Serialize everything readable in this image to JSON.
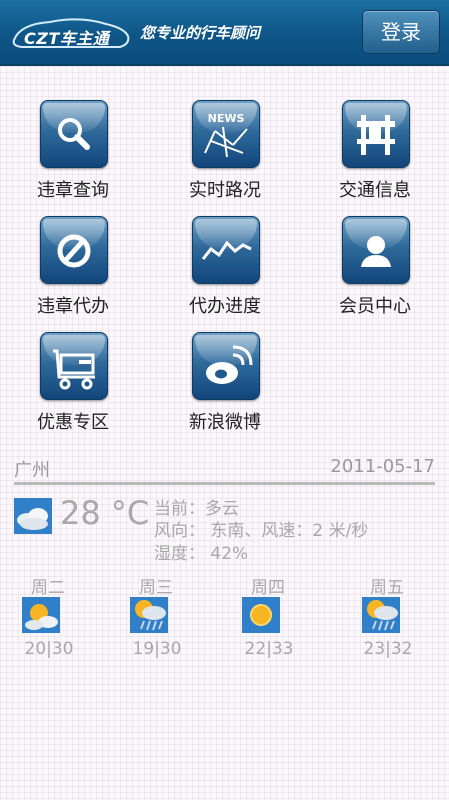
{
  "header": {
    "logo_text": "CZT车主通",
    "slogan": "您专业的行车顾问",
    "login_label": "登录"
  },
  "menu": [
    {
      "label": "违章查询",
      "icon": "search-icon"
    },
    {
      "label": "实时路况",
      "icon": "news-map-icon"
    },
    {
      "label": "交通信息",
      "icon": "road-sign-icon"
    },
    {
      "label": "违章代办",
      "icon": "prohibited-icon"
    },
    {
      "label": "代办进度",
      "icon": "progress-chart-icon"
    },
    {
      "label": "会员中心",
      "icon": "member-icon"
    },
    {
      "label": "优惠专区",
      "icon": "shopping-cart-icon"
    },
    {
      "label": "新浪微博",
      "icon": "weibo-icon"
    }
  ],
  "weather": {
    "city": "广州",
    "date": "2011-05-17",
    "temperature": "28 °C",
    "current": "当前：多云",
    "wind": "风向： 东南、风速：2 米/秒",
    "humidity": "湿度： 42%",
    "forecast": [
      {
        "day": "周二",
        "temps": "20|30",
        "icon": "partly-cloudy-icon"
      },
      {
        "day": "周三",
        "temps": "19|30",
        "icon": "sun-rain-icon"
      },
      {
        "day": "周四",
        "temps": "22|33",
        "icon": "sunny-icon"
      },
      {
        "day": "周五",
        "temps": "23|32",
        "icon": "sun-rain-icon"
      }
    ]
  }
}
